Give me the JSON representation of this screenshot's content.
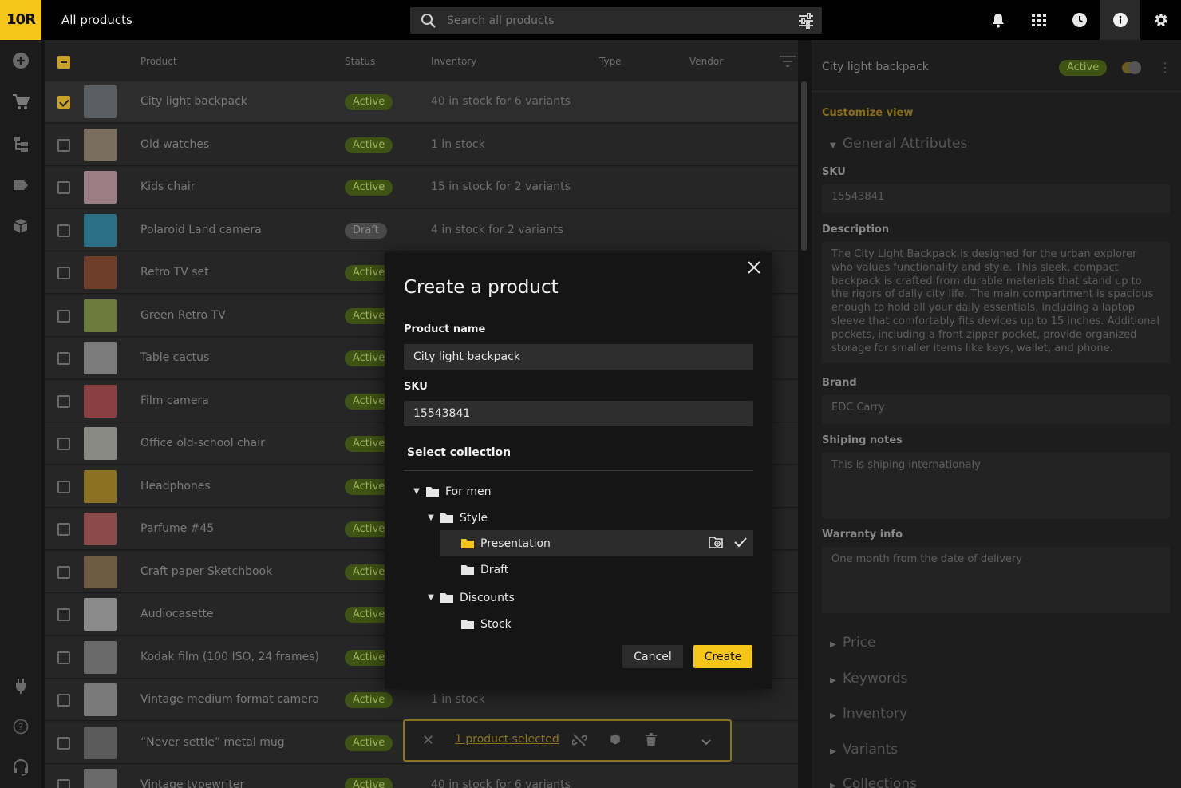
{
  "topbar": {
    "logo": "10R",
    "title": "All products",
    "search_placeholder": "Search all products"
  },
  "table": {
    "headers": {
      "product": "Product",
      "status": "Status",
      "inventory": "Inventory",
      "type": "Type",
      "vendor": "Vendor"
    },
    "rows": [
      {
        "name": "City light backpack",
        "status": "Active",
        "inventory": "40 in stock for 6 variants",
        "selected": true,
        "color": "#5a5e62"
      },
      {
        "name": "Old watches",
        "status": "Active",
        "inventory": "1 in stock",
        "color": "#7a6e5e"
      },
      {
        "name": "Kids chair",
        "status": "Active",
        "inventory": "15 in stock for 2 variants",
        "color": "#9a7d85"
      },
      {
        "name": "Polaroid Land camera",
        "status": "Draft",
        "inventory": "4 in stock for 2 variants",
        "color": "#2a6f86"
      },
      {
        "name": "Retro TV set",
        "status": "Active",
        "inventory": "",
        "color": "#6e3e2a"
      },
      {
        "name": "Green Retro TV",
        "status": "Active",
        "inventory": "",
        "color": "#6c7a3a"
      },
      {
        "name": "Table cactus",
        "status": "Active",
        "inventory": "",
        "color": "#7b7b7b"
      },
      {
        "name": "Film camera",
        "status": "Active",
        "inventory": "",
        "color": "#8a4040"
      },
      {
        "name": "Office old-school chair",
        "status": "Active",
        "inventory": "",
        "color": "#8a8a84"
      },
      {
        "name": "Headphones",
        "status": "Active",
        "inventory": "",
        "color": "#8a7222"
      },
      {
        "name": "Parfume #45",
        "status": "Active",
        "inventory": "",
        "color": "#8a4a4a"
      },
      {
        "name": "Craft paper Sketchbook",
        "status": "Active",
        "inventory": "",
        "color": "#6e5a40"
      },
      {
        "name": "Audiocasette",
        "status": "Active",
        "inventory": "",
        "color": "#8a8a8a"
      },
      {
        "name": "Kodak film (100 ISO, 24 frames)",
        "status": "Active",
        "inventory": "",
        "color": "#6a6a6a"
      },
      {
        "name": "Vintage medium format camera",
        "status": "Active",
        "inventory": "1 in stock",
        "color": "#7a7a7a"
      },
      {
        "name": "“Never settle” metal mug",
        "status": "Active",
        "inventory": "",
        "color": "#5a5a5a"
      },
      {
        "name": "Vintage typewriter",
        "status": "Active",
        "inventory": "40 in stock for 6 variants",
        "color": "#6a6a6a"
      }
    ]
  },
  "bulk": {
    "selected_text": "1 product selected"
  },
  "panel": {
    "title": "City light backpack",
    "status": "Active",
    "customize": "Customize view",
    "general": "General Attributes",
    "sku_label": "SKU",
    "sku_value": "15543841",
    "desc_label": "Description",
    "desc_value": "The City Light Backpack is designed for the urban explorer who values functionality and style. This sleek, compact backpack is crafted from durable materials that stand up to the rigors of daily city life. The main compartment is spacious enough to hold all your daily essentials, including a laptop sleeve that comfortably fits devices up to 15 inches. Additional pockets, including a front zipper pocket, provide organized storage for smaller items like keys, wallet, and phone.",
    "brand_label": "Brand",
    "brand_value": "EDC Carry",
    "shipping_label": "Shiping notes",
    "shipping_value": "This is shiping internationaly",
    "warranty_label": "Warranty info",
    "warranty_value": "One month from the date of delivery",
    "sections": [
      "Price",
      "Keywords",
      "Inventory",
      "Variants",
      "Collections"
    ]
  },
  "modal": {
    "title": "Create a product",
    "name_label": "Product name",
    "name_value": "City light backpack",
    "sku_label": "SKU",
    "sku_value": "15543841",
    "collection_label": "Select collection",
    "tree": {
      "for_men": "For men",
      "style": "Style",
      "presentation": "Presentation",
      "draft": "Draft",
      "discounts": "Discounts",
      "stock": "Stock"
    },
    "cancel": "Cancel",
    "create": "Create"
  },
  "colors": {
    "accent": "#f5c518",
    "active_badge": "#3f5414"
  }
}
